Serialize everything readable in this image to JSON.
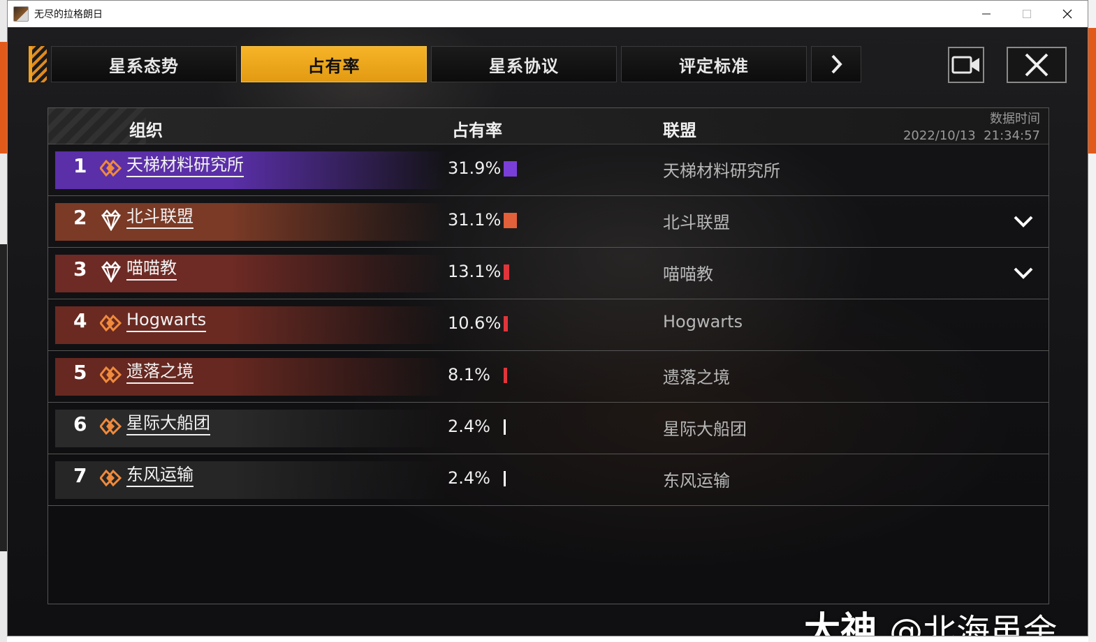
{
  "window": {
    "title": "无尽的拉格朗日"
  },
  "tabs": [
    {
      "label": "星系态势",
      "active": false
    },
    {
      "label": "占有率",
      "active": true
    },
    {
      "label": "星系协议",
      "active": false
    },
    {
      "label": "评定标准",
      "active": false
    }
  ],
  "tab_next_symbol": "›",
  "colors": {
    "tab_active": "#f0a820",
    "accent_orange": "#e08a1e"
  },
  "table": {
    "headers": {
      "org": "组织",
      "rate": "占有率",
      "alliance": "联盟"
    },
    "data_time_label": "数据时间",
    "data_time_value": "2022/10/13  21:34:57",
    "rows": [
      {
        "rank": "1",
        "org": "天梯材料研究所",
        "pct": "31.9%",
        "pct_value": 31.9,
        "alliance": "天梯材料研究所",
        "icon": "diamond-icon",
        "expandable": false,
        "bar_color": "#7a3fd8",
        "row_color": "#5a2fa8"
      },
      {
        "rank": "2",
        "org": "北斗联盟",
        "pct": "31.1%",
        "pct_value": 31.1,
        "alliance": "北斗联盟",
        "icon": "crown-gem-icon",
        "expandable": true,
        "bar_color": "#e2603a",
        "row_color": "#7a3a26"
      },
      {
        "rank": "3",
        "org": "喵喵教",
        "pct": "13.1%",
        "pct_value": 13.1,
        "alliance": "喵喵教",
        "icon": "crown-gem-icon",
        "expandable": true,
        "bar_color": "#e0353a",
        "row_color": "#6e2a24"
      },
      {
        "rank": "4",
        "org": "Hogwarts",
        "pct": "10.6%",
        "pct_value": 10.6,
        "alliance": "Hogwarts",
        "icon": "diamond-icon",
        "expandable": false,
        "bar_color": "#e0353a",
        "row_color": "#6a2a22"
      },
      {
        "rank": "5",
        "org": "遗落之境",
        "pct": "8.1%",
        "pct_value": 8.1,
        "alliance": "遗落之境",
        "icon": "diamond-icon",
        "expandable": false,
        "bar_color": "#e0353a",
        "row_color": "#662820"
      },
      {
        "rank": "6",
        "org": "星际大船团",
        "pct": "2.4%",
        "pct_value": 2.4,
        "alliance": "星际大船团",
        "icon": "diamond-icon",
        "expandable": false,
        "bar_color": "#ffffff",
        "row_color": "#2a2a2a"
      },
      {
        "rank": "7",
        "org": "东风运输",
        "pct": "2.4%",
        "pct_value": 2.4,
        "alliance": "东风运输",
        "icon": "diamond-icon",
        "expandable": false,
        "bar_color": "#ffffff",
        "row_color": "#262626"
      }
    ]
  },
  "watermark": {
    "brand": "大神",
    "handle": "@北海虽余"
  }
}
